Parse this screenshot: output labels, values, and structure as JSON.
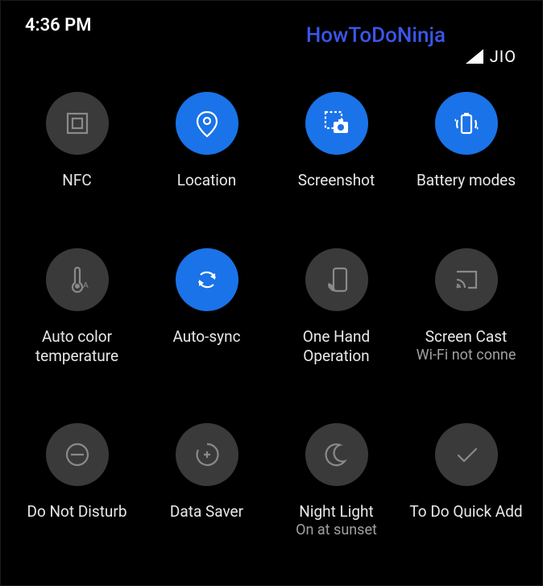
{
  "status": {
    "time": "4:36 PM",
    "carrier": "JIO"
  },
  "annotation": {
    "label": "HowToDoNinja"
  },
  "tiles": [
    {
      "label": "NFC",
      "sublabel": "",
      "active": false
    },
    {
      "label": "Location",
      "sublabel": "",
      "active": true
    },
    {
      "label": "Screenshot",
      "sublabel": "",
      "active": true
    },
    {
      "label": "Battery modes",
      "sublabel": "",
      "active": true
    },
    {
      "label": "Auto color temperature",
      "sublabel": "",
      "active": false
    },
    {
      "label": "Auto-sync",
      "sublabel": "",
      "active": true
    },
    {
      "label": "One Hand Operation",
      "sublabel": "",
      "active": false
    },
    {
      "label": "Screen Cast",
      "sublabel": "Wi-Fi not conne",
      "active": false
    },
    {
      "label": "Do Not Disturb",
      "sublabel": "",
      "active": false
    },
    {
      "label": "Data Saver",
      "sublabel": "",
      "active": false
    },
    {
      "label": "Night Light",
      "sublabel": "On at sunset",
      "active": false
    },
    {
      "label": "To Do Quick Add",
      "sublabel": "",
      "active": false
    }
  ]
}
